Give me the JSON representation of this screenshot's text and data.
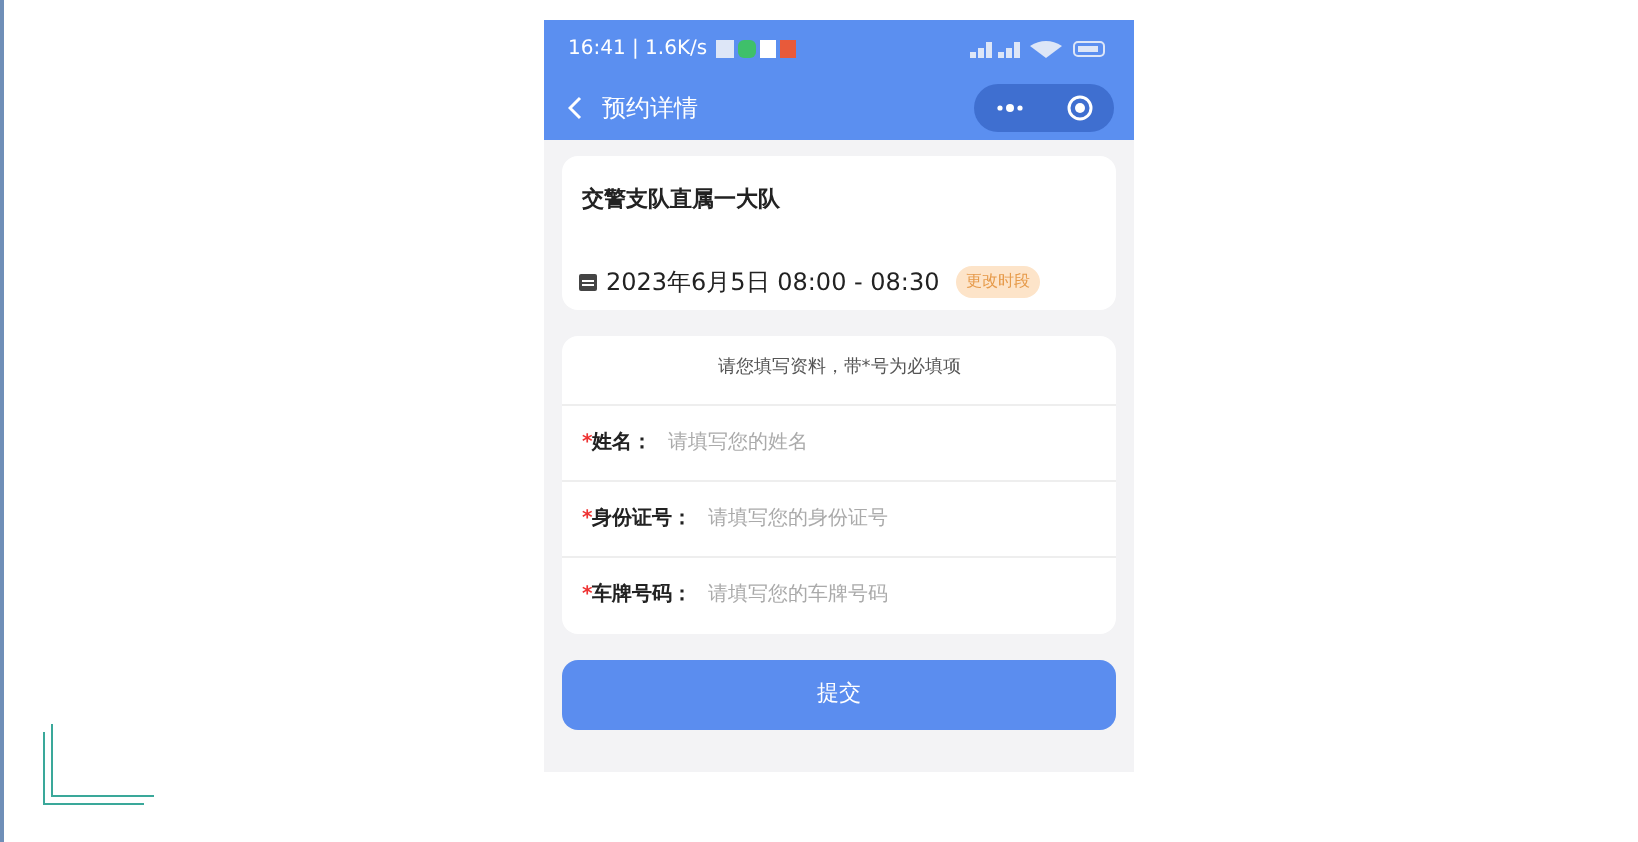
{
  "status_bar": {
    "text": "16:41 | 1.6K/s"
  },
  "nav_bar": {
    "title": "预约详情"
  },
  "appointment": {
    "unit": "交警支队直属一大队",
    "datetime": "2023年6月5日 08:00 - 08:30",
    "change_badge": "更改时段"
  },
  "form": {
    "hint": "请您填写资料，带*号为必填项",
    "fields": [
      {
        "mark": "*",
        "label": "姓名：",
        "placeholder": "请填写您的姓名"
      },
      {
        "mark": "*",
        "label": "身份证号：",
        "placeholder": "请填写您的身份证号"
      },
      {
        "mark": "*",
        "label": "车牌号码：",
        "placeholder": "请填写您的车牌号码"
      }
    ]
  },
  "submit_button": "提交"
}
